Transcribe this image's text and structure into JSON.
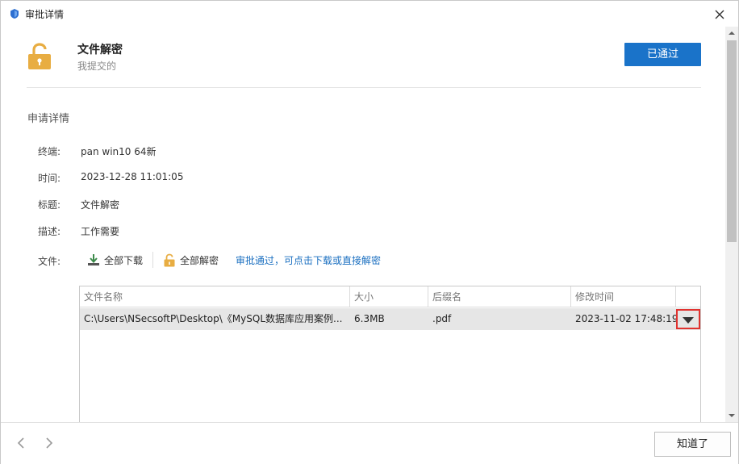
{
  "window": {
    "title": "审批详情"
  },
  "header": {
    "title": "文件解密",
    "subtitle": "我提交的",
    "status": "已通过"
  },
  "details": {
    "section_title": "申请详情",
    "rows": [
      {
        "label": "终端:",
        "value": "pan win10 64新"
      },
      {
        "label": "时间:",
        "value": "2023-12-28 11:01:05"
      },
      {
        "label": "标题:",
        "value": "文件解密"
      },
      {
        "label": "描述:",
        "value": "工作需要"
      }
    ],
    "files_label": "文件:"
  },
  "file_actions": {
    "download_all": "全部下载",
    "decrypt_all": "全部解密",
    "hint": "审批通过，可点击下载或直接解密"
  },
  "file_table": {
    "columns": [
      "文件名称",
      "大小",
      "后缀名",
      "修改时间"
    ],
    "rows": [
      {
        "name": "C:\\Users\\NSecsoftP\\Desktop\\《MySQL数据库应用案例...",
        "size": "6.3MB",
        "ext": ".pdf",
        "modified": "2023-11-02 17:48:19"
      }
    ]
  },
  "footer": {
    "ok_label": "知道了"
  },
  "colors": {
    "accent": "#1a73c9",
    "lock": "#e8ad42",
    "highlight_border": "#e0322f",
    "link": "#1a6fc0"
  },
  "icons": {
    "title": "app-shield-icon",
    "lock": "unlocked-padlock-icon",
    "download": "download-icon",
    "decrypt": "small-padlock-icon",
    "dropdown": "triangle-down-icon"
  }
}
